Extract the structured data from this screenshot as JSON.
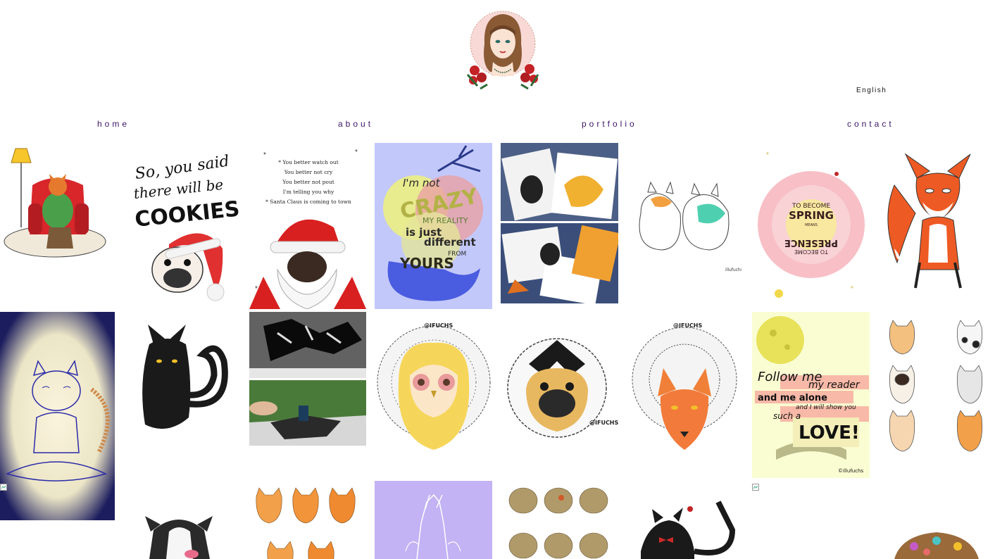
{
  "header": {
    "logo_alt": "Illufuchs logo portrait",
    "language": "English"
  },
  "nav": {
    "home": "home",
    "about": "about",
    "portfolio": "portfolio",
    "contact": "contact"
  },
  "gallery": {
    "tiles": {
      "fox_armchair": {},
      "cookies": {
        "line1": "So, you said",
        "line2": "there will be",
        "line3": "COOKIES..."
      },
      "santa": {
        "l1": "* You better watch out",
        "l2": "You better not cry",
        "l3": "You better not pout",
        "l4": "I'm telling you why",
        "l5": "* Santa Claus is coming to town"
      },
      "crazy": {
        "l1": "I'm not",
        "l2": "CRAZY",
        "l3": "MY REALITY",
        "l4": "is just",
        "l5": "different",
        "l6": "FROM",
        "l7": "YOURS"
      },
      "cards": {},
      "cats_pair": {
        "signature": "illufuchs"
      },
      "spring": {
        "l1": "TO BECOME",
        "l2": "SPRING",
        "l3": "MEANS",
        "l4": "PRESENCE",
        "l5": "TO BECOME"
      },
      "fox_standing": {},
      "yoga_cat": {},
      "black_cat": {},
      "papercut": {},
      "owl": {
        "tag": "@IFUCHS"
      },
      "pug": {
        "tag": "@IFUCHS"
      },
      "fox_mandala": {
        "tag": "@IFUCHS"
      },
      "follow_me": {
        "l1": "Follow me",
        "l2": "my reader",
        "l3": "and me alone",
        "l4": "and I will show you",
        "l5": "such a",
        "l6": "LOVE!",
        "signature": "©illufuchs"
      },
      "cat_grid": {},
      "dog": {},
      "fox_grid": {},
      "hands": {},
      "hamsters": {},
      "black_cat_red": {},
      "hedgehog": {}
    }
  },
  "colors": {
    "nav_link": "#3a1466",
    "crazy_bg": "#c3c8fb",
    "hands_bg": "#c3b2f4",
    "follow_bg": "#fafdd2",
    "yoga_bg": "#1c1d5e"
  }
}
